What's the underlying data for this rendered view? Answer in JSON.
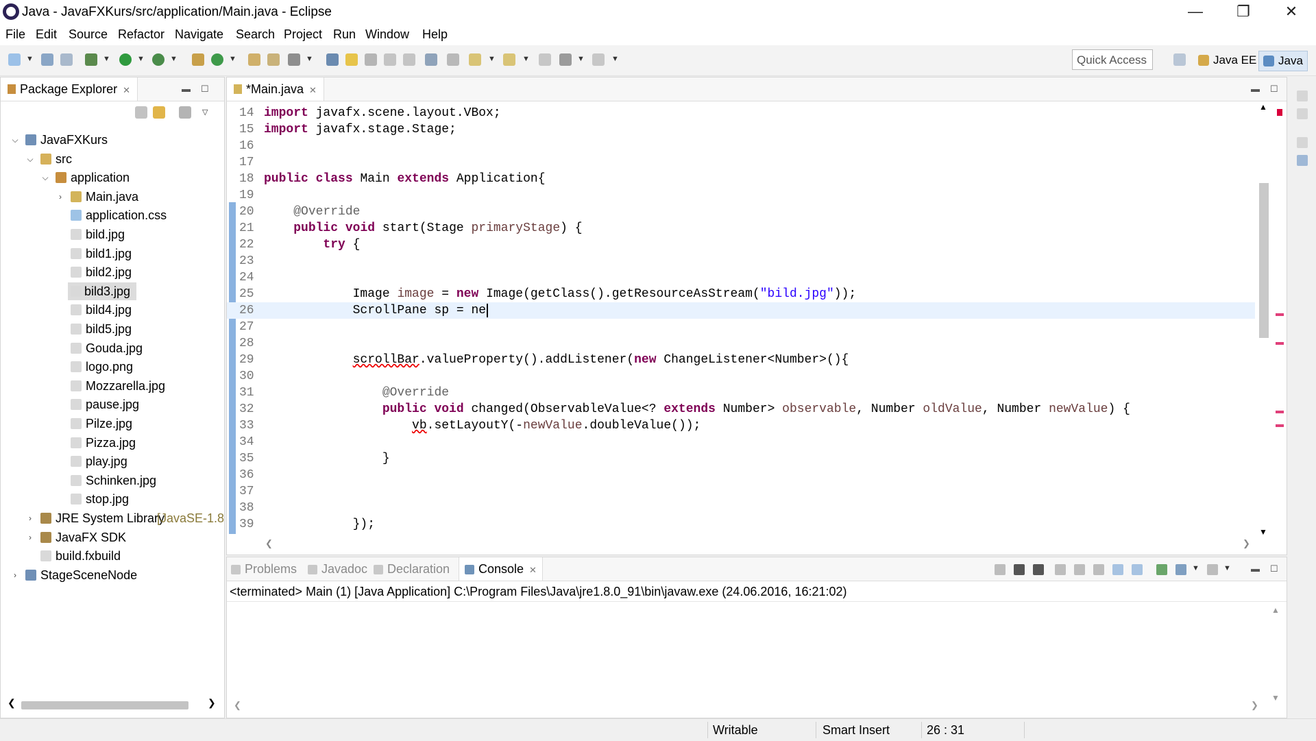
{
  "window": {
    "title": "Java - JavaFXKurs/src/application/Main.java - Eclipse",
    "minimize": "—",
    "restore": "❐",
    "close": "✕"
  },
  "menu": [
    "File",
    "Edit",
    "Source",
    "Refactor",
    "Navigate",
    "Search",
    "Project",
    "Run",
    "Window",
    "Help"
  ],
  "toolbar": {
    "quick_access": "Quick Access",
    "perspective_java_ee": "Java EE",
    "perspective_java": "Java"
  },
  "package_explorer": {
    "tab_label": "Package Explorer",
    "close": "✕",
    "tree": [
      {
        "label": "JavaFXKurs",
        "suffix": ""
      },
      {
        "label": "src",
        "suffix": ""
      },
      {
        "label": "application",
        "suffix": ""
      },
      {
        "label": "Main.java",
        "suffix": ""
      },
      {
        "label": "application.css",
        "suffix": ""
      },
      {
        "label": "bild.jpg",
        "suffix": ""
      },
      {
        "label": "bild1.jpg",
        "suffix": ""
      },
      {
        "label": "bild2.jpg",
        "suffix": ""
      },
      {
        "label": "bild3.jpg",
        "suffix": ""
      },
      {
        "label": "bild4.jpg",
        "suffix": ""
      },
      {
        "label": "bild5.jpg",
        "suffix": ""
      },
      {
        "label": "Gouda.jpg",
        "suffix": ""
      },
      {
        "label": "logo.png",
        "suffix": ""
      },
      {
        "label": "Mozzarella.jpg",
        "suffix": ""
      },
      {
        "label": "pause.jpg",
        "suffix": ""
      },
      {
        "label": "Pilze.jpg",
        "suffix": ""
      },
      {
        "label": "Pizza.jpg",
        "suffix": ""
      },
      {
        "label": "play.jpg",
        "suffix": ""
      },
      {
        "label": "Schinken.jpg",
        "suffix": ""
      },
      {
        "label": "stop.jpg",
        "suffix": ""
      },
      {
        "label": "JRE System Library",
        "suffix": "[JavaSE-1.8"
      },
      {
        "label": "JavaFX SDK",
        "suffix": ""
      },
      {
        "label": "build.fxbuild",
        "suffix": ""
      },
      {
        "label": "StageSceneNode",
        "suffix": ""
      }
    ]
  },
  "editor": {
    "tab_label": "*Main.java",
    "close": "✕",
    "lines": [
      {
        "n": "14",
        "tokens": [
          [
            "kw",
            "import"
          ],
          [
            "t",
            " javafx.scene.layout.VBox;"
          ]
        ]
      },
      {
        "n": "15",
        "tokens": [
          [
            "kw",
            "import"
          ],
          [
            "t",
            " javafx.stage.Stage;"
          ]
        ]
      },
      {
        "n": "16",
        "tokens": []
      },
      {
        "n": "17",
        "tokens": []
      },
      {
        "n": "18",
        "tokens": [
          [
            "kw",
            "public"
          ],
          [
            "t",
            " "
          ],
          [
            "kw",
            "class"
          ],
          [
            "t",
            " Main "
          ],
          [
            "kw",
            "extends"
          ],
          [
            "t",
            " Application{"
          ]
        ]
      },
      {
        "n": "19",
        "tokens": []
      },
      {
        "n": "20",
        "tokens": [
          [
            "t",
            "    "
          ],
          [
            "ann",
            "@Override"
          ]
        ]
      },
      {
        "n": "21",
        "tokens": [
          [
            "t",
            "    "
          ],
          [
            "kw",
            "public"
          ],
          [
            "t",
            " "
          ],
          [
            "kw",
            "void"
          ],
          [
            "t",
            " start(Stage "
          ],
          [
            "param",
            "primaryStage"
          ],
          [
            "t",
            ") {"
          ]
        ]
      },
      {
        "n": "22",
        "tokens": [
          [
            "t",
            "        "
          ],
          [
            "kw",
            "try"
          ],
          [
            "t",
            " {"
          ]
        ]
      },
      {
        "n": "23",
        "tokens": []
      },
      {
        "n": "24",
        "tokens": []
      },
      {
        "n": "25",
        "tokens": [
          [
            "t",
            "            Image "
          ],
          [
            "param",
            "image"
          ],
          [
            "t",
            " = "
          ],
          [
            "kw",
            "new"
          ],
          [
            "t",
            " Image(getClass().getResourceAsStream("
          ],
          [
            "str",
            "\"bild.jpg\""
          ],
          [
            "t",
            "));"
          ]
        ]
      },
      {
        "n": "26",
        "tokens": [
          [
            "t",
            "            ScrollPane sp = ne"
          ]
        ]
      },
      {
        "n": "27",
        "tokens": []
      },
      {
        "n": "28",
        "tokens": []
      },
      {
        "n": "29",
        "tokens": [
          [
            "t",
            "            "
          ],
          [
            "err",
            "scrollBar"
          ],
          [
            "t",
            ".valueProperty().addListener("
          ],
          [
            "kw",
            "new"
          ],
          [
            "t",
            " ChangeListener<Number>(){"
          ]
        ]
      },
      {
        "n": "30",
        "tokens": []
      },
      {
        "n": "31",
        "tokens": [
          [
            "t",
            "                "
          ],
          [
            "ann",
            "@Override"
          ]
        ]
      },
      {
        "n": "32",
        "tokens": [
          [
            "t",
            "                "
          ],
          [
            "kw",
            "public"
          ],
          [
            "t",
            " "
          ],
          [
            "kw",
            "void"
          ],
          [
            "t",
            " changed(ObservableValue<? "
          ],
          [
            "kw",
            "extends"
          ],
          [
            "t",
            " Number> "
          ],
          [
            "param",
            "observable"
          ],
          [
            "t",
            ", Number "
          ],
          [
            "param",
            "oldValue"
          ],
          [
            "t",
            ", Number "
          ],
          [
            "param",
            "newValue"
          ],
          [
            "t",
            ") {"
          ]
        ]
      },
      {
        "n": "33",
        "tokens": [
          [
            "t",
            "                    "
          ],
          [
            "err",
            "vb"
          ],
          [
            "t",
            ".setLayoutY(-"
          ],
          [
            "param",
            "newValue"
          ],
          [
            "t",
            ".doubleValue());"
          ]
        ]
      },
      {
        "n": "34",
        "tokens": []
      },
      {
        "n": "35",
        "tokens": [
          [
            "t",
            "                }"
          ]
        ]
      },
      {
        "n": "36",
        "tokens": []
      },
      {
        "n": "37",
        "tokens": []
      },
      {
        "n": "38",
        "tokens": []
      },
      {
        "n": "39",
        "tokens": [
          [
            "t",
            "            });"
          ]
        ]
      }
    ]
  },
  "console": {
    "tabs": [
      "Problems",
      "Javadoc",
      "Declaration",
      "Console"
    ],
    "close": "✕",
    "status": "<terminated> Main (1) [Java Application] C:\\Program Files\\Java\\jre1.8.0_91\\bin\\javaw.exe (24.06.2016, 16:21:02)"
  },
  "statusbar": {
    "writable": "Writable",
    "insert_mode": "Smart Insert",
    "position": "26 : 31"
  },
  "colors": {
    "keyword": "#7f0055",
    "string": "#2a00ff",
    "annotation": "#646464",
    "parameter": "#6a3e3e",
    "current_line": "#e8f2fe"
  }
}
